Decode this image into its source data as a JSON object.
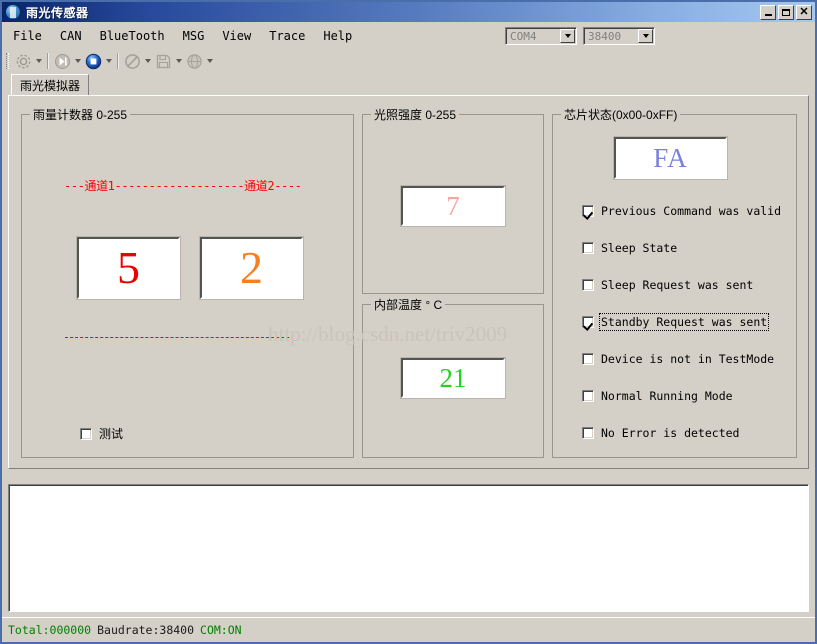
{
  "window": {
    "title": "雨光传感器",
    "icon": "app-sensor-icon",
    "minimize_label": "",
    "maximize_label": "",
    "close_label": "✕"
  },
  "menu": {
    "items": [
      {
        "label": "File"
      },
      {
        "label": "CAN"
      },
      {
        "label": "BlueTooth"
      },
      {
        "label": "MSG"
      },
      {
        "label": "View"
      },
      {
        "label": "Trace"
      },
      {
        "label": "Help"
      }
    ],
    "port_combo": {
      "value": "COM4",
      "enabled": false
    },
    "baud_combo": {
      "value": "38400",
      "enabled": false
    }
  },
  "toolbar": {
    "buttons": [
      {
        "name": "settings-gear-icon",
        "enabled": false,
        "has_dropdown": true
      },
      {
        "name": "play-next-icon",
        "enabled": false,
        "has_dropdown": true
      },
      {
        "name": "stop-circle-icon",
        "enabled": true,
        "has_dropdown": true
      },
      {
        "name": "block-prohibited-icon",
        "enabled": false,
        "has_dropdown": true
      },
      {
        "name": "save-floppy-icon",
        "enabled": false,
        "has_dropdown": true
      },
      {
        "name": "globe-icon",
        "enabled": false,
        "has_dropdown": true
      }
    ]
  },
  "tabs": [
    {
      "label": "雨光模拟器",
      "active": true
    }
  ],
  "groups": {
    "rain_counter": {
      "title": "雨量计数器 0-255",
      "channel_markers": "---通道1-------------------通道2----",
      "channel1": {
        "label": "通道1",
        "value": "5",
        "color": "#ee0000"
      },
      "channel2": {
        "label": "通道2",
        "value": "2",
        "color": "#f58020"
      },
      "test_checkbox": {
        "label": "测试",
        "checked": false
      }
    },
    "light_intensity": {
      "title": "光照强度 0-255",
      "value": "7",
      "color": "#f4a6a0"
    },
    "internal_temperature": {
      "title": "内部温度 ° C",
      "value": "21",
      "color": "#22d422"
    },
    "chip_status": {
      "title": "芯片状态(0x00-0xFF)",
      "value": "FA",
      "color": "#7b7fe0",
      "flags": [
        {
          "label": "Previous Command was valid",
          "checked": true,
          "focused": false
        },
        {
          "label": "Sleep State",
          "checked": false,
          "focused": false
        },
        {
          "label": "Sleep Request was sent",
          "checked": false,
          "focused": false
        },
        {
          "label": "Standby Request was sent",
          "checked": true,
          "focused": true
        },
        {
          "label": "Device is not in TestMode",
          "checked": false,
          "focused": false
        },
        {
          "label": "Normal Running Mode",
          "checked": false,
          "focused": false
        },
        {
          "label": "No Error is detected",
          "checked": false,
          "focused": false
        }
      ]
    }
  },
  "log": {
    "content": ""
  },
  "watermark": {
    "text": "http://blog.csdn.net/triv2009"
  },
  "statusbar": {
    "total": "Total:000000",
    "baudrate": "Baudrate:38400",
    "com": "COM:ON"
  }
}
